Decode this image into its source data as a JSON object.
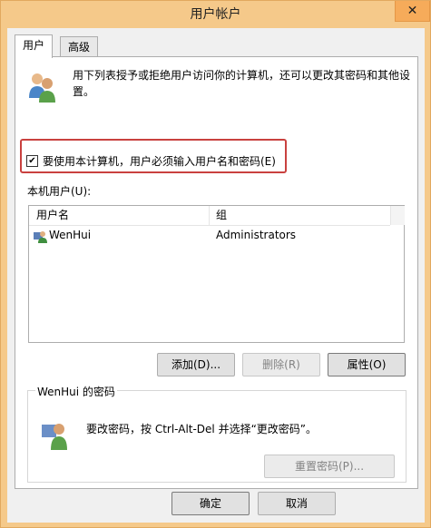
{
  "window": {
    "title": "用户帐户",
    "close_glyph": "✕"
  },
  "tabs": [
    {
      "label": "用户",
      "active": true
    },
    {
      "label": "高级",
      "active": false
    }
  ],
  "intro_text": "用下列表授予或拒绝用户访问你的计算机，还可以更改其密码和其他设置。",
  "require_login": {
    "label": "要使用本计算机，用户必须输入用户名和密码(E)",
    "checked": true,
    "check_glyph": "✔"
  },
  "users_label": "本机用户(U):",
  "users_table": {
    "columns": [
      "用户名",
      "组"
    ],
    "rows": [
      {
        "name": "WenHui",
        "group": "Administrators",
        "icon": "user-icon"
      }
    ]
  },
  "buttons": {
    "add": "添加(D)...",
    "remove": "删除(R)",
    "properties": "属性(O)"
  },
  "password_section": {
    "title": "WenHui 的密码",
    "text": "要改密码，按 Ctrl-Alt-Del 并选择“更改密码”。",
    "reset_label": "重置密码(P)..."
  },
  "footer": {
    "ok": "确定",
    "cancel": "取消"
  },
  "icons": [
    "users-icon",
    "key-icon",
    "user-icon",
    "close-icon",
    "checkmark-icon"
  ],
  "colors": {
    "title_bar": "#f5c98a",
    "highlight_border": "#c9413f"
  }
}
